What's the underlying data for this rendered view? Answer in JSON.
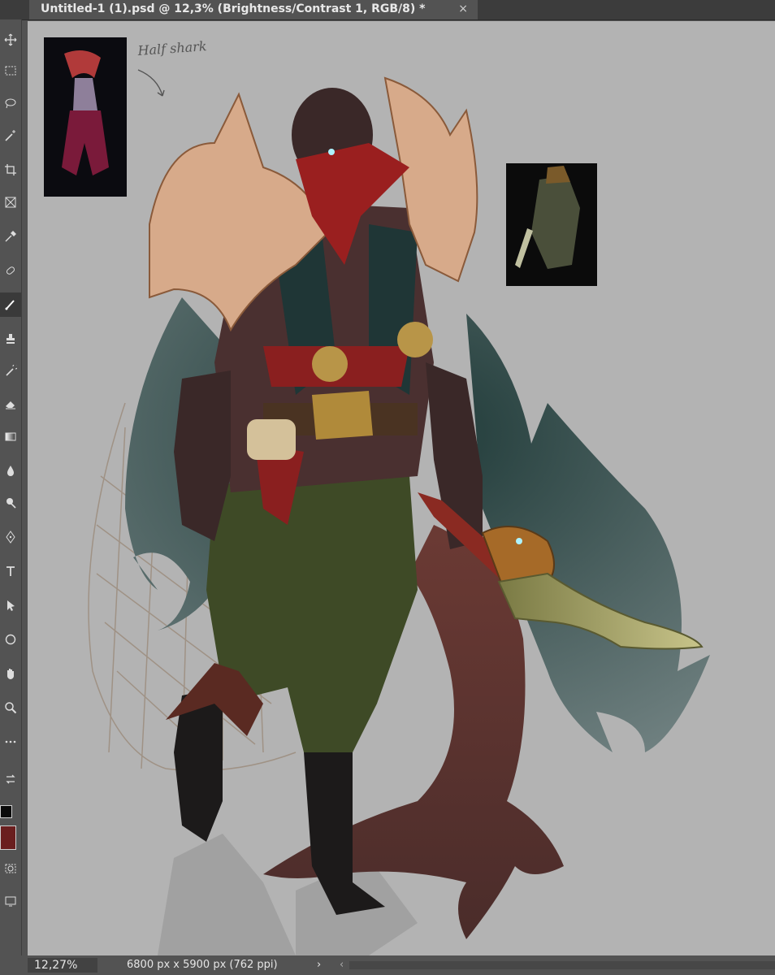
{
  "document_tab": {
    "title": "Untitled-1 (1).psd @ 12,3% (Brightness/Contrast 1, RGB/8) *",
    "close_glyph": "×"
  },
  "toolbar": {
    "tools": [
      "move-icon",
      "marquee-icon",
      "lasso-icon",
      "magic-wand-icon",
      "crop-icon",
      "frame-icon",
      "eyedropper-icon",
      "healing-brush-icon",
      "brush-icon",
      "clone-stamp-icon",
      "history-brush-icon",
      "eraser-icon",
      "gradient-icon",
      "blur-icon",
      "dodge-icon",
      "pen-icon",
      "type-icon",
      "path-selection-icon",
      "ellipse-shape-icon",
      "hand-icon",
      "zoom-icon",
      "more-tools-icon",
      "swap-colors-icon"
    ],
    "active_tool": "brush-icon",
    "foreground_color": "#0a0a0a",
    "background_color": "#6a1f1f"
  },
  "canvas": {
    "note_text": "Half shark",
    "background_color": "#b3b3b3"
  },
  "status_bar": {
    "zoom": "12,27%",
    "document_info": "6800 px x 5900 px (762 ppi)",
    "arrow": "›",
    "left_arrow": "‹"
  }
}
